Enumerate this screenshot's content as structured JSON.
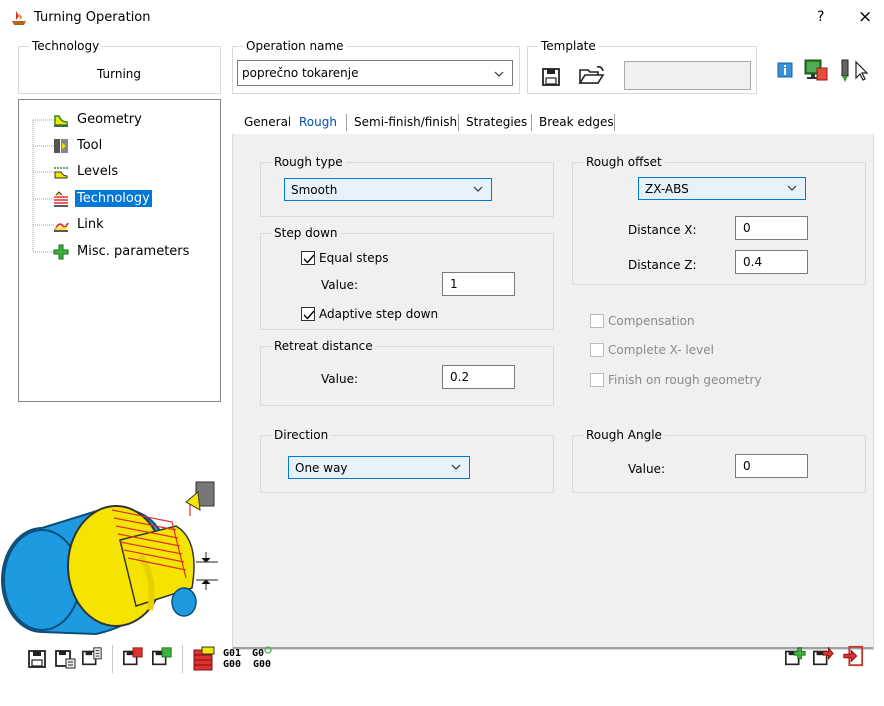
{
  "window": {
    "title": "Turning Operation",
    "help_label": "?",
    "close_label": "×"
  },
  "technology": {
    "label": "Technology",
    "value": "Turning"
  },
  "operation_name": {
    "label": "Operation name",
    "value": "poprečno tokarenje"
  },
  "template": {
    "label": "Template",
    "value": ""
  },
  "tree": {
    "items": [
      {
        "label": "Geometry",
        "icon": "geometry-icon"
      },
      {
        "label": "Tool",
        "icon": "tool-icon"
      },
      {
        "label": "Levels",
        "icon": "levels-icon"
      },
      {
        "label": "Technology",
        "icon": "technology-icon",
        "selected": true
      },
      {
        "label": "Link",
        "icon": "link-icon"
      },
      {
        "label": "Misc. parameters",
        "icon": "plus-icon"
      }
    ]
  },
  "tabs": [
    {
      "label": "General"
    },
    {
      "label": "Rough",
      "active": true
    },
    {
      "label": "Semi-finish/finish"
    },
    {
      "label": "Strategies"
    },
    {
      "label": "Break edges"
    }
  ],
  "rough": {
    "rough_type": {
      "label": "Rough type",
      "value": "Smooth"
    },
    "step_down": {
      "label": "Step down",
      "equal_steps": {
        "label": "Equal steps",
        "checked": true
      },
      "value_label": "Value:",
      "value": "1",
      "adaptive": {
        "label": "Adaptive step down",
        "checked": true
      }
    },
    "retreat": {
      "label": "Retreat distance",
      "value_label": "Value:",
      "value": "0.2"
    },
    "direction": {
      "label": "Direction",
      "value": "One way"
    },
    "rough_offset": {
      "label": "Rough offset",
      "value": "ZX-ABS",
      "distance_x_label": "Distance X:",
      "distance_x": "0",
      "distance_z_label": "Distance Z:",
      "distance_z": "0.4"
    },
    "compensation": {
      "label": "Compensation",
      "checked": false,
      "enabled": false
    },
    "complete_x_level": {
      "label": "Complete X- level",
      "checked": false,
      "enabled": false
    },
    "finish_on_rough": {
      "label": "Finish on rough geometry",
      "checked": false,
      "enabled": false
    },
    "rough_angle": {
      "label": "Rough Angle",
      "value_label": "Value:",
      "value": "0"
    }
  },
  "toolbar": {
    "g01_line1": "G01",
    "g01_line2": "G00",
    "g0_line1": "G0",
    "g0_line2": "G00"
  },
  "colors": {
    "accent": "#0078d7",
    "part_blue": "#1e9be0",
    "part_yellow": "#f5e400",
    "toolpath_red": "#e03030"
  }
}
